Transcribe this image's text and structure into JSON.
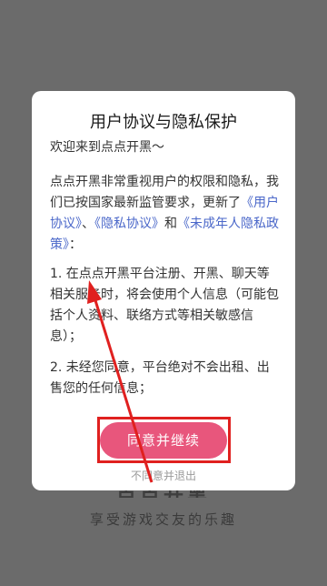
{
  "background": {
    "logo_text": "点点开黑",
    "slogan": "享受游戏交友的乐趣"
  },
  "dialog": {
    "title": "用户协议与隐私保护",
    "welcome": "欢迎来到点点开黑～",
    "intro": {
      "prefix": "点点开黑非常重视用户的权限和隐私，我们已按国家最新监管要求，更新了",
      "link1": "《用户协议》",
      "sep1": "、",
      "link2": "《隐私协议》",
      "sep2": "和",
      "link3": "《未成年人隐私政策》",
      "suffix": "："
    },
    "item1": "1. 在点点开黑平台注册、开黑、聊天等相关服务时，将会使用个人信息（可能包括个人资料、联络方式等相关敏感信息）；",
    "item2": "2. 未经您同意，平台绝对不会出租、出售您的任何信息；",
    "agree_label": "同意并继续",
    "decline_label": "不同意并退出"
  },
  "colors": {
    "overlay": "#6d6d6d",
    "accent": "#e8567c",
    "link": "#4a67c9",
    "annotation": "#e0201f"
  }
}
